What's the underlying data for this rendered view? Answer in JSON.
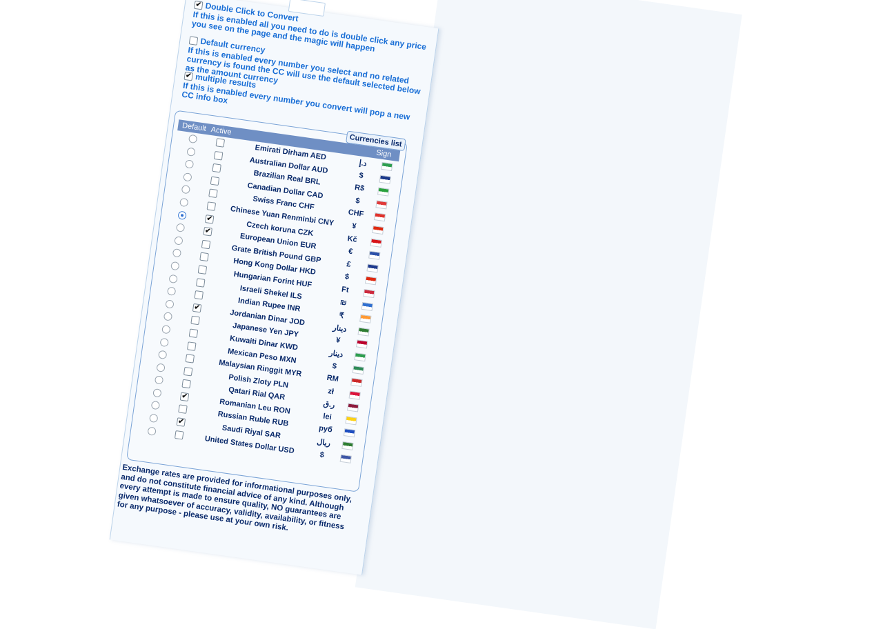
{
  "options": [
    {
      "label": "Double Click to Convert",
      "checked": true,
      "description": "If this is enabled all you need to do is double click any price you see on the page and the magic will happen"
    },
    {
      "label": "Default currency",
      "checked": false,
      "description": "If this is enabled every number you select and no related currency is found the CC will use the default selected below as the amount currency"
    },
    {
      "label": "multiple results",
      "checked": true,
      "description": "If this is enabled every number you convert will pop a new CC info box"
    }
  ],
  "currencies_list": {
    "legend": "Currencies list",
    "headers": {
      "default": "Default",
      "active": "Active",
      "sign": "Sign"
    },
    "rows": [
      {
        "name": "Emirati Dirham AED",
        "sign": "د.إ",
        "default": false,
        "active": false,
        "flag": "ae-flag-icon",
        "flag_color": "#2e9e4f"
      },
      {
        "name": "Australian Dollar AUD",
        "sign": "$",
        "default": false,
        "active": false,
        "flag": "au-flag-icon",
        "flag_color": "#1b3a8a"
      },
      {
        "name": "Brazilian Real BRL",
        "sign": "R$",
        "default": false,
        "active": false,
        "flag": "br-flag-icon",
        "flag_color": "#2aa13d"
      },
      {
        "name": "Canadian Dollar CAD",
        "sign": "$",
        "default": false,
        "active": false,
        "flag": "ca-flag-icon",
        "flag_color": "#e03a3a"
      },
      {
        "name": "Swiss Franc CHF",
        "sign": "CHF",
        "default": false,
        "active": false,
        "flag": "ch-flag-icon",
        "flag_color": "#e0322b"
      },
      {
        "name": "Chinese Yuan Renminbi CNY",
        "sign": "¥",
        "default": false,
        "active": false,
        "flag": "cn-flag-icon",
        "flag_color": "#de2910"
      },
      {
        "name": "Czech koruna CZK",
        "sign": "Kč",
        "default": true,
        "active": true,
        "flag": "cz-flag-icon",
        "flag_color": "#d7141a"
      },
      {
        "name": "European Union EUR",
        "sign": "€",
        "default": false,
        "active": true,
        "flag": "eu-flag-icon",
        "flag_color": "#2a4fa8"
      },
      {
        "name": "Grate British Pound GBP",
        "sign": "£",
        "default": false,
        "active": false,
        "flag": "gb-flag-icon",
        "flag_color": "#1f3b8f"
      },
      {
        "name": "Hong Kong Dollar HKD",
        "sign": "$",
        "default": false,
        "active": false,
        "flag": "hk-flag-icon",
        "flag_color": "#de2910"
      },
      {
        "name": "Hungarian Forint HUF",
        "sign": "Ft",
        "default": false,
        "active": false,
        "flag": "hu-flag-icon",
        "flag_color": "#cd2a3e"
      },
      {
        "name": "Israeli Shekel ILS",
        "sign": "₪",
        "default": false,
        "active": false,
        "flag": "il-flag-icon",
        "flag_color": "#2f6fd0"
      },
      {
        "name": "Indian Rupee INR",
        "sign": "₹",
        "default": false,
        "active": false,
        "flag": "in-flag-icon",
        "flag_color": "#ff9933"
      },
      {
        "name": "Jordanian Dinar JOD",
        "sign": "دينار",
        "default": false,
        "active": true,
        "flag": "jo-flag-icon",
        "flag_color": "#2e7d32"
      },
      {
        "name": "Japanese Yen JPY",
        "sign": "¥",
        "default": false,
        "active": false,
        "flag": "jp-flag-icon",
        "flag_color": "#bc002d"
      },
      {
        "name": "Kuwaiti Dinar KWD",
        "sign": "دينار",
        "default": false,
        "active": false,
        "flag": "kw-flag-icon",
        "flag_color": "#2e9e4f"
      },
      {
        "name": "Mexican Peso MXN",
        "sign": "$",
        "default": false,
        "active": false,
        "flag": "mx-flag-icon",
        "flag_color": "#2e8b57"
      },
      {
        "name": "Malaysian Ringgit MYR",
        "sign": "RM",
        "default": false,
        "active": false,
        "flag": "my-flag-icon",
        "flag_color": "#cc2a2a"
      },
      {
        "name": "Polish Zloty PLN",
        "sign": "zł",
        "default": false,
        "active": false,
        "flag": "pl-flag-icon",
        "flag_color": "#dc143c"
      },
      {
        "name": "Qatari Rial QAR",
        "sign": "ر.ق",
        "default": false,
        "active": false,
        "flag": "qa-flag-icon",
        "flag_color": "#8d1b3d"
      },
      {
        "name": "Romanian Leu RON",
        "sign": "lei",
        "default": false,
        "active": true,
        "flag": "ro-flag-icon",
        "flag_color": "#fcd116"
      },
      {
        "name": "Russian Ruble RUB",
        "sign": "руб",
        "default": false,
        "active": false,
        "flag": "ru-flag-icon",
        "flag_color": "#1f4fc0"
      },
      {
        "name": "Saudi Riyal SAR",
        "sign": "ريال",
        "default": false,
        "active": true,
        "flag": "sa-flag-icon",
        "flag_color": "#2e7d32"
      },
      {
        "name": "United States Dollar USD",
        "sign": "$",
        "default": false,
        "active": false,
        "flag": "us-flag-icon",
        "flag_color": "#3c55a5"
      }
    ]
  },
  "disclaimer": "Exchange rates are provided for informational purposes only, and do not constitute financial advice of any kind. Although every attempt is made to ensure quality, NO guarantees are given whatsoever of accuracy, validity, availability, or fitness for any purpose - please use at your own risk."
}
